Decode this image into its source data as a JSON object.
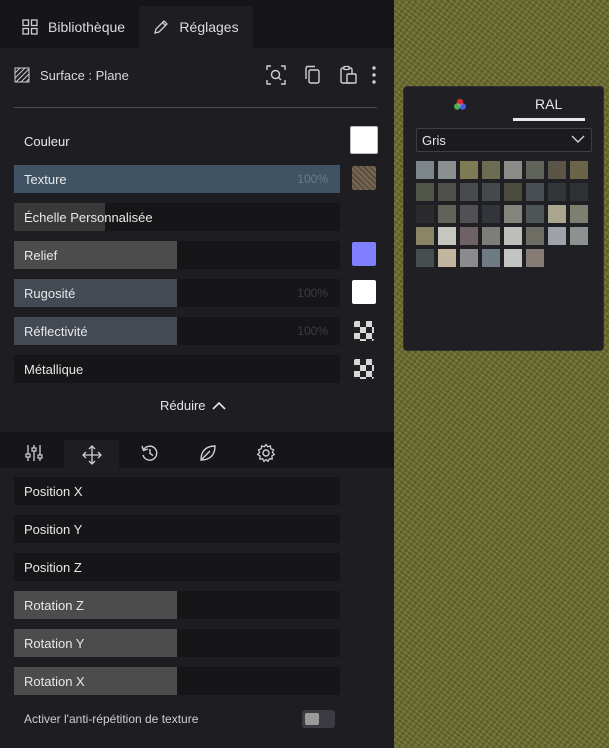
{
  "tabs": {
    "library": "Bibliothèque",
    "settings": "Réglages"
  },
  "surface": {
    "label": "Surface : Plane"
  },
  "props": [
    {
      "name": "Couleur",
      "pct": "",
      "fill": 0,
      "fillColor": "",
      "swatch": "#ffffff",
      "type": "color"
    },
    {
      "name": "Texture",
      "pct": "100%",
      "fill": 1.0,
      "fillColor": "#3f5365",
      "swatch": "#6f5f4a",
      "type": "texture"
    },
    {
      "name": "Échelle Personnalisée",
      "pct": "",
      "fill": 0.28,
      "fillColor": "#393939",
      "swatch": "",
      "type": "none"
    },
    {
      "name": "Relief",
      "pct": "",
      "fill": 0.5,
      "fillColor": "#4c4c4c",
      "swatch": "#8080ff",
      "type": "color"
    },
    {
      "name": "Rugosité",
      "pct": "100%",
      "fill": 0.5,
      "fillColor": "#434a54",
      "swatch": "#ffffff",
      "type": "color"
    },
    {
      "name": "Réflectivité",
      "pct": "100%",
      "fill": 0.5,
      "fillColor": "#434a54",
      "swatch": "",
      "type": "checker"
    },
    {
      "name": "Métallique",
      "pct": "",
      "fill": 0,
      "fillColor": "",
      "swatch": "",
      "type": "checker"
    }
  ],
  "reduce_label": "Réduire",
  "transform": [
    {
      "name": "Position X",
      "fill": 0
    },
    {
      "name": "Position Y",
      "fill": 0
    },
    {
      "name": "Position Z",
      "fill": 0
    },
    {
      "name": "Rotation Z",
      "fill": 0.5
    },
    {
      "name": "Rotation Y",
      "fill": 0.5
    },
    {
      "name": "Rotation X",
      "fill": 0.5
    }
  ],
  "anti_repeat_label": "Activer l'anti-répétition de texture",
  "ral": {
    "tab": "RAL",
    "selected": "Gris",
    "colors": [
      "#7c8589",
      "#8a8f8f",
      "#7e7a56",
      "#6c6c50",
      "#8b8c88",
      "#5f6359",
      "#5a5546",
      "#6c6449",
      "#505647",
      "#4f5049",
      "#474b4c",
      "#444a4c",
      "#4a4b3c",
      "#494d54",
      "#313638",
      "#2f3234",
      "#2b2b2d",
      "#5f6358",
      "#4f5154",
      "#323539",
      "#83857b",
      "#4e5557",
      "#a9a68d",
      "#7c8070",
      "#8a8565",
      "#c6c7c0",
      "#6f6266",
      "#7f7d78",
      "#bdbfbb",
      "#6e6d63",
      "#9ea3a9",
      "#8d9190",
      "#474e4e",
      "#c1b79f",
      "#8a8b8c",
      "#6e7b84",
      "#c3c3c1",
      "#867b75"
    ]
  }
}
